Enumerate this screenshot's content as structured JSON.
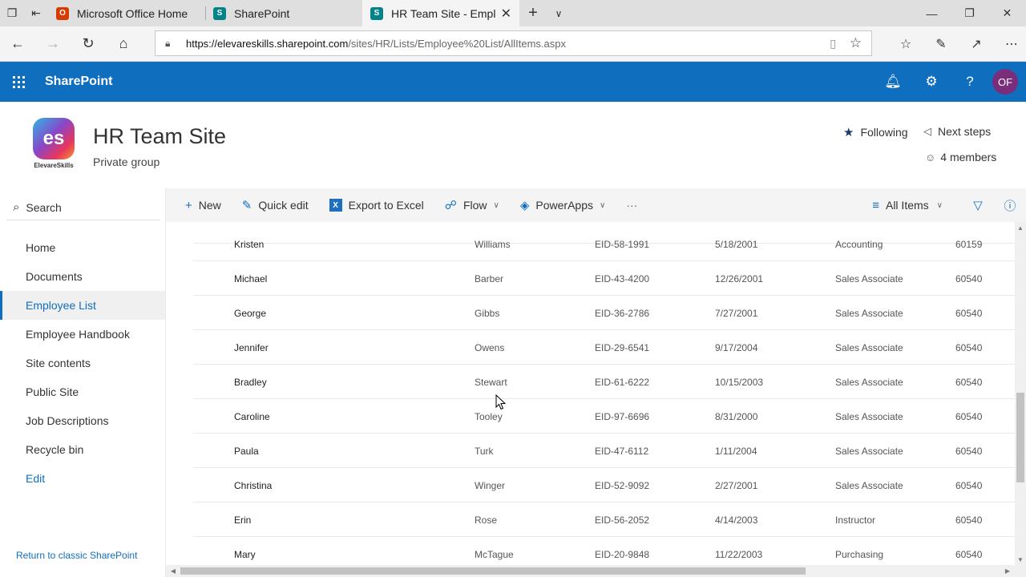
{
  "browser": {
    "tabs": [
      {
        "label": "Microsoft Office Home",
        "icon": "office-icon",
        "color": "#d83b01",
        "active": false
      },
      {
        "label": "SharePoint",
        "icon": "sharepoint-icon",
        "color": "#038387",
        "active": false
      },
      {
        "label": "HR Team Site - Employe",
        "icon": "sharepoint-icon",
        "color": "#038387",
        "active": true
      }
    ],
    "url_host": "https://elevareskills.sharepoint.com",
    "url_path": "/sites/HR/Lists/Employee%20List/AllItems.aspx"
  },
  "suitebar": {
    "brand": "SharePoint",
    "avatar_initials": "OF",
    "color": "#106ebe"
  },
  "site": {
    "logo_initials": "es",
    "logo_text": "ElevareSkills",
    "title": "HR Team Site",
    "subtitle": "Private group",
    "following": "Following",
    "next_steps": "Next steps",
    "members": "4 members"
  },
  "leftnav": {
    "search_label": "Search",
    "items": [
      {
        "label": "Home"
      },
      {
        "label": "Documents"
      },
      {
        "label": "Employee List",
        "active": true
      },
      {
        "label": "Employee Handbook"
      },
      {
        "label": "Site contents"
      },
      {
        "label": "Public Site"
      },
      {
        "label": "Job Descriptions"
      },
      {
        "label": "Recycle bin"
      },
      {
        "label": "Edit"
      }
    ],
    "classic_link": "Return to classic SharePoint"
  },
  "commandbar": {
    "new": "New",
    "quick_edit": "Quick edit",
    "export": "Export to Excel",
    "flow": "Flow",
    "powerapps": "PowerApps",
    "more": "···",
    "view": "All Items"
  },
  "list": {
    "rows": [
      [
        "Kristen",
        "Williams",
        "EID-58-1991",
        "5/18/2001",
        "Accounting",
        "60159"
      ],
      [
        "Michael",
        "Barber",
        "EID-43-4200",
        "12/26/2001",
        "Sales Associate",
        "60540"
      ],
      [
        "George",
        "Gibbs",
        "EID-36-2786",
        "7/27/2001",
        "Sales Associate",
        "60540"
      ],
      [
        "Jennifer",
        "Owens",
        "EID-29-6541",
        "9/17/2004",
        "Sales Associate",
        "60540"
      ],
      [
        "Bradley",
        "Stewart",
        "EID-61-6222",
        "10/15/2003",
        "Sales Associate",
        "60540"
      ],
      [
        "Caroline",
        "Tooley",
        "EID-97-6696",
        "8/31/2000",
        "Sales Associate",
        "60540"
      ],
      [
        "Paula",
        "Turk",
        "EID-47-6112",
        "1/11/2004",
        "Sales Associate",
        "60540"
      ],
      [
        "Christina",
        "Winger",
        "EID-52-9092",
        "2/27/2001",
        "Sales Associate",
        "60540"
      ],
      [
        "Erin",
        "Rose",
        "EID-56-2052",
        "4/14/2003",
        "Instructor",
        "60540"
      ],
      [
        "Mary",
        "McTague",
        "EID-20-9848",
        "11/22/2003",
        "Purchasing",
        "60540"
      ]
    ]
  }
}
